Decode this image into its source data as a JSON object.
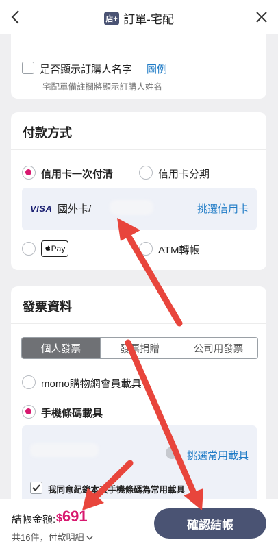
{
  "header": {
    "title": "訂單-宅配",
    "badge": "店+"
  },
  "buyer_name": {
    "label": "是否顯示訂購人名字",
    "link": "圖例",
    "description": "宅配單備註欄將顯示訂購人姓名"
  },
  "payment": {
    "title": "付款方式",
    "options": [
      {
        "label": "信用卡一次付清",
        "selected": true
      },
      {
        "label": "信用卡分期",
        "selected": false
      },
      {
        "label": "Pay",
        "selected": false
      },
      {
        "label": "ATM轉帳",
        "selected": false
      }
    ],
    "card_brand": "VISA",
    "card_label": "國外卡/",
    "pick_card": "挑選信用卡"
  },
  "invoice": {
    "title": "發票資料",
    "tabs": [
      "個人發票",
      "發票捐贈",
      "公司用發票"
    ],
    "active_tab": 0,
    "carrier_options": [
      {
        "label": "momo購物網會員載具",
        "selected": false
      },
      {
        "label": "手機條碼載具",
        "selected": true
      }
    ],
    "pick_carrier": "挑選常用載具",
    "agree_text": "我同意紀錄本次手機條碼為常用載具"
  },
  "checkout": {
    "total_label": "結帳金額:",
    "currency": "$",
    "amount": "691",
    "count_text": "共16件，付款明細",
    "confirm": "確認結帳"
  },
  "colors": {
    "brand": "#4a5373",
    "accent": "#d8186f",
    "link": "#1f7bc6",
    "annotation": "#e8453c"
  }
}
